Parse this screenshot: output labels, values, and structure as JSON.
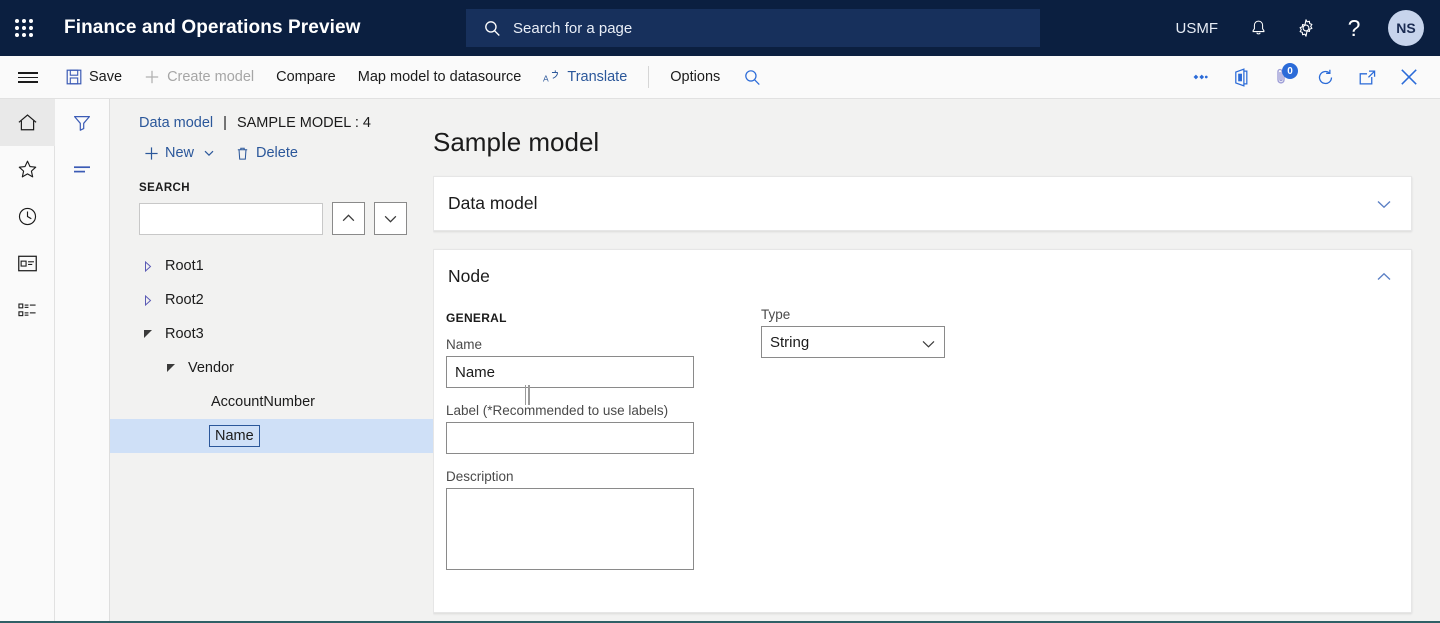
{
  "topbar": {
    "waffle_label": "app-launcher",
    "app_title": "Finance and Operations Preview",
    "search_placeholder": "Search for a page",
    "company": "USMF",
    "avatar_initials": "NS",
    "icons": [
      "notification-bell-icon",
      "settings-gear-icon",
      "help-question-icon"
    ]
  },
  "commandbar": {
    "save_label": "Save",
    "create_model_label": "Create model",
    "compare_label": "Compare",
    "map_model_label": "Map model to datasource",
    "translate_label": "Translate",
    "options_label": "Options",
    "attachment_badge": "0",
    "right_icons": [
      "related-information-icon",
      "office-integration-icon",
      "attachments-icon",
      "refresh-icon",
      "open-in-new-window-icon",
      "close-icon"
    ]
  },
  "navrail": {
    "items": [
      {
        "name": "home",
        "icon": "home-icon",
        "active": true
      },
      {
        "name": "favorites",
        "icon": "star-icon",
        "active": false
      },
      {
        "name": "recent",
        "icon": "clock-icon",
        "active": false
      },
      {
        "name": "workspaces",
        "icon": "workspace-icon",
        "active": false
      },
      {
        "name": "modules",
        "icon": "list-icon",
        "active": false
      }
    ]
  },
  "actionrail": {
    "items": [
      {
        "name": "filter",
        "icon": "filter-icon"
      },
      {
        "name": "lines",
        "icon": "lines-icon"
      }
    ]
  },
  "treepane": {
    "breadcrumb": {
      "link": "Data model",
      "divider": "|",
      "current": "SAMPLE MODEL : 4"
    },
    "tools": {
      "new_label": "New",
      "delete_label": "Delete"
    },
    "search": {
      "label": "SEARCH",
      "value": "",
      "placeholder": "",
      "prev_label": "previous-match",
      "next_label": "next-match"
    },
    "nodes": [
      {
        "label": "Root1",
        "depth": 1,
        "twisty": "collapsed",
        "selected": false
      },
      {
        "label": "Root2",
        "depth": 1,
        "twisty": "collapsed",
        "selected": false
      },
      {
        "label": "Root3",
        "depth": 1,
        "twisty": "expanded",
        "selected": false
      },
      {
        "label": "Vendor",
        "depth": 2,
        "twisty": "expanded",
        "selected": false
      },
      {
        "label": "AccountNumber",
        "depth": 3,
        "twisty": "none",
        "selected": false
      },
      {
        "label": "Name",
        "depth": 3,
        "twisty": "none",
        "selected": true
      }
    ]
  },
  "detail": {
    "page_title": "Sample model",
    "sections": [
      {
        "title": "Data model",
        "expanded": false,
        "chevron": "chevron-down-icon"
      },
      {
        "title": "Node",
        "expanded": true,
        "chevron": "chevron-up-icon"
      }
    ],
    "node_form": {
      "group_header": "GENERAL",
      "name_label": "Name",
      "name_value": "Name",
      "label_label": "Label (*Recommended to use labels)",
      "label_value": "",
      "description_label": "Description",
      "description_value": "",
      "type_label": "Type",
      "type_value": "String",
      "type_options": [
        "String"
      ]
    }
  },
  "colors": {
    "topbar_bg": "#0b1f40",
    "accent_blue": "#2b579a",
    "icon_blue": "#2b6bd8",
    "selection_blue": "#cfe0f7",
    "page_bg": "#f2f2f1"
  }
}
